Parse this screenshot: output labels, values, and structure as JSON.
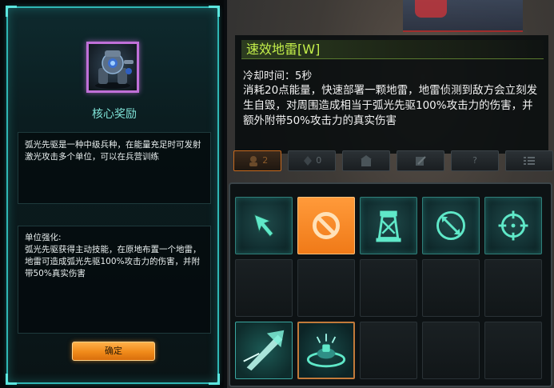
{
  "left_panel": {
    "title": "核心奖励",
    "description": "弧光先驱是一种中级兵种，在能量充足时可发射激光攻击多个单位，可以在兵营训练",
    "upgrade_heading": "单位强化:",
    "upgrade_text": "弧光先驱获得主动技能，在原地布置一个地雷，地雷可造成弧光先驱100%攻击力的伤害，并附带50%真实伤害",
    "confirm_label": "确定",
    "frame_color": "#2fb6b4"
  },
  "tooltip": {
    "ability_name": "速效地雷",
    "hotkey": "[W]",
    "cooldown": "冷却时间：5秒",
    "description": "消耗20点能量，快速部署一颗地雷，地雷侦测到敌方会立刻发生自毁，对周围造成相当于弧光先驱100%攻击力的伤害，并额外附带50%攻击力的真实伤害",
    "title_color": "#c4f04a"
  },
  "tabs": [
    {
      "label": "2",
      "icon": "unit-icon",
      "active": true
    },
    {
      "label": "0",
      "icon": "resource-icon",
      "active": false
    },
    {
      "label": "",
      "icon": "building-icon",
      "active": false
    },
    {
      "label": "",
      "icon": "upgrade-icon",
      "active": false
    },
    {
      "label": "?",
      "icon": "help-icon",
      "active": false
    },
    {
      "label": "",
      "icon": "menu-icon",
      "active": false
    }
  ],
  "command_card": {
    "row1": [
      "move-arrow-icon",
      "stop-icon",
      "hold-tower-icon",
      "patrol-icon",
      "attack-target-icon"
    ],
    "row3": [
      "laser-ability-icon",
      "mine-ability-icon"
    ],
    "accent_color": "#f07a18"
  }
}
